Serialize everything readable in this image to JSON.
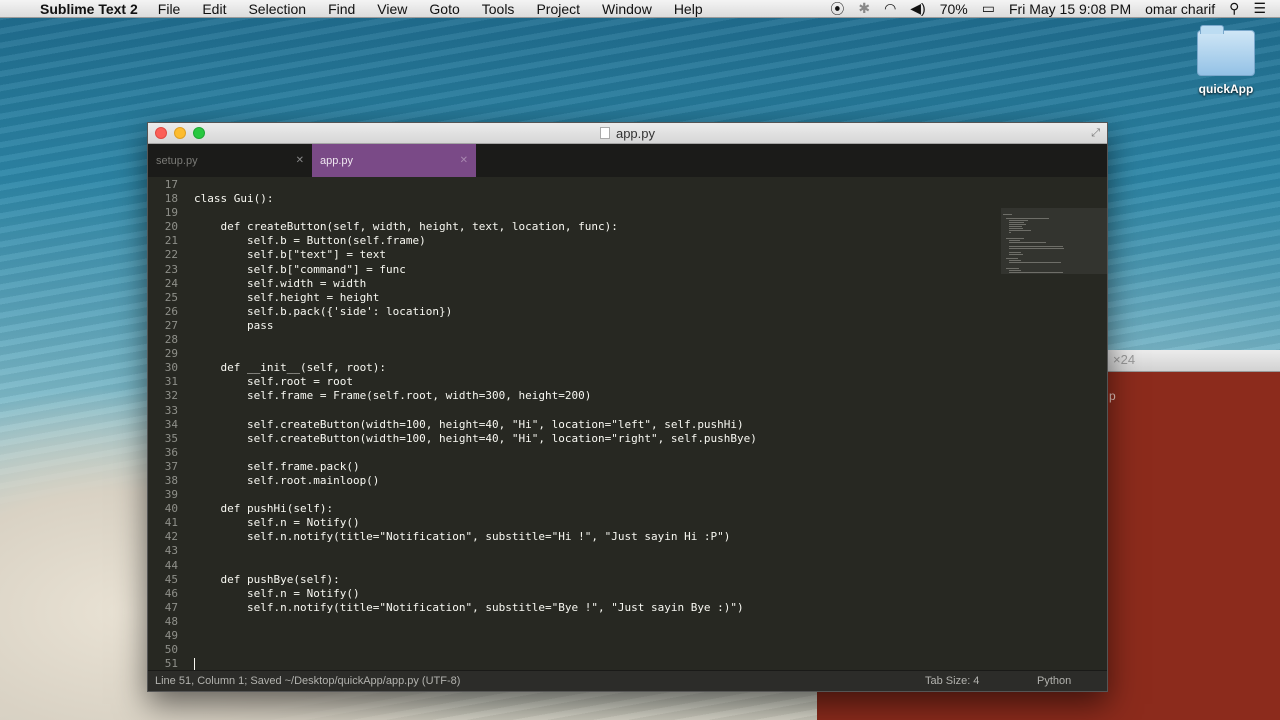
{
  "menubar": {
    "app_name": "Sublime Text 2",
    "items": [
      "File",
      "Edit",
      "Selection",
      "Find",
      "View",
      "Goto",
      "Tools",
      "Project",
      "Window",
      "Help"
    ],
    "battery": "70%",
    "datetime": "Fri May 15  9:08 PM",
    "user": "omar charif"
  },
  "desktop": {
    "folder_label": "quickApp"
  },
  "background_window": {
    "title_fragment": "×24",
    "text_fragment": "p"
  },
  "editor": {
    "window_title": "app.py",
    "tabs": [
      {
        "label": "setup.py",
        "active": false
      },
      {
        "label": "app.py",
        "active": true
      }
    ],
    "line_numbers": [
      "17",
      "18",
      "19",
      "20",
      "21",
      "22",
      "23",
      "24",
      "25",
      "26",
      "27",
      "28",
      "29",
      "30",
      "31",
      "32",
      "33",
      "34",
      "35",
      "36",
      "37",
      "38",
      "39",
      "40",
      "41",
      "42",
      "43",
      "44",
      "45",
      "46",
      "47",
      "48",
      "49",
      "50",
      "51"
    ],
    "lines": [
      "",
      "class Gui():",
      "",
      "    def createButton(self, width, height, text, location, func):",
      "        self.b = Button(self.frame)",
      "        self.b[\"text\"] = text",
      "        self.b[\"command\"] = func",
      "        self.width = width",
      "        self.height = height",
      "        self.b.pack({'side': location})",
      "        pass",
      "",
      "",
      "    def __init__(self, root):",
      "        self.root = root",
      "        self.frame = Frame(self.root, width=300, height=200)",
      "",
      "        self.createButton(width=100, height=40, \"Hi\", location=\"left\", self.pushHi)",
      "        self.createButton(width=100, height=40, \"Hi\", location=\"right\", self.pushBye)",
      "",
      "        self.frame.pack()",
      "        self.root.mainloop()",
      "",
      "    def pushHi(self):",
      "        self.n = Notify()",
      "        self.n.notify(title=\"Notification\", substitle=\"Hi !\", \"Just sayin Hi :P\")",
      "",
      "",
      "    def pushBye(self):",
      "        self.n = Notify()",
      "        self.n.notify(title=\"Notification\", substitle=\"Bye !\", \"Just sayin Bye :)\")",
      "",
      "",
      "",
      ""
    ],
    "status": {
      "left": "Line 51, Column 1; Saved ~/Desktop/quickApp/app.py (UTF-8)",
      "tab_size": "Tab Size: 4",
      "syntax": "Python"
    },
    "theme_colors": {
      "background": "#272822",
      "active_tab": "#7a4a87",
      "text": "#f8f8f2",
      "gutter": "#8f908a"
    }
  }
}
